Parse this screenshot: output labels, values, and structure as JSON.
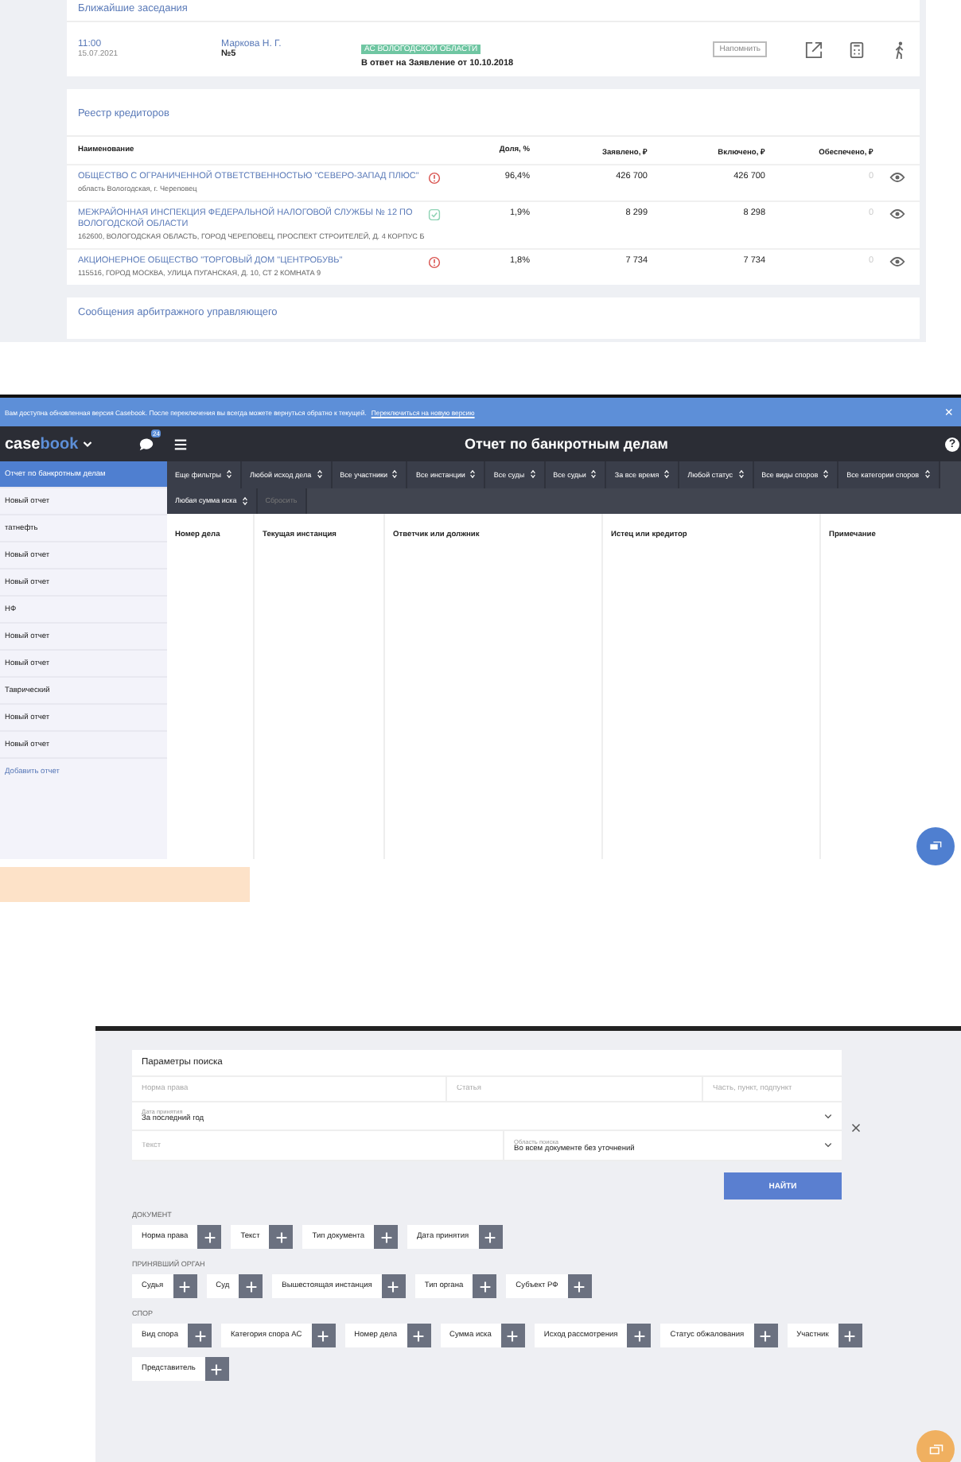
{
  "hearings": {
    "title": "Ближайшие заседания",
    "rows": [
      {
        "time": "11:00",
        "date": "15.07.2021",
        "judge": "Маркова Н. Г.",
        "room": "№5",
        "court_tag": "АС ВОЛОГОДСКОЙ ОБЛАСТИ",
        "description": "В ответ на Заявление от 10.10.2018",
        "remind_button": "Напомнить"
      }
    ]
  },
  "creditors": {
    "title": "Реестр кредиторов",
    "columns": [
      "Наименование",
      "Доля, %",
      "Заявлено, ₽",
      "Включено, ₽",
      "Обеспечено, ₽"
    ],
    "rows": [
      {
        "name": "ОБЩЕСТВО С ОГРАНИЧЕННОЙ ОТВЕТСТВЕННОСТЬЮ \"СЕВЕРО-ЗАПАД ПЛЮС\"",
        "address": "область Вологодская, г. Череповец",
        "kind": "alert",
        "share": "96,4%",
        "claimed": "426 700",
        "included": "426 700",
        "secured": "0"
      },
      {
        "name": "МЕЖРАЙОННАЯ ИНСПЕКЦИЯ ФЕДЕРАЛЬНОЙ НАЛОГОВОЙ СЛУЖБЫ № 12 ПО ВОЛОГОДСКОЙ ОБЛАСТИ",
        "address": "162600, ВОЛОГОДСКАЯ ОБЛАСТЬ, ГОРОД ЧЕРЕПОВЕЦ, ПРОСПЕКТ СТРОИТЕЛЕЙ, Д. 4 КОРПУС Б",
        "kind": "check",
        "share": "1,9%",
        "claimed": "8 299",
        "included": "8 298",
        "secured": "0"
      },
      {
        "name": "АКЦИОНЕРНОЕ ОБЩЕСТВО \"ТОРГОВЫЙ ДОМ \"ЦЕНТРОБУВЬ\"",
        "address": "115516, ГОРОД МОСКВА, УЛИЦА ПУГАНСКАЯ, Д. 10, СТ 2 КОМНАТА 9",
        "kind": "alert",
        "share": "1,8%",
        "claimed": "7 734",
        "included": "7 734",
        "secured": "0"
      }
    ]
  },
  "messages": {
    "title": "Сообщения арбитражного управляющего"
  },
  "banner": {
    "text": "Вам доступна обновленная версия Casebook. После переключения вы всегда можете вернуться обратно к текущей.",
    "link": "Переключиться на новую версию",
    "close": "×"
  },
  "app": {
    "logo_a": "case",
    "logo_b": "book",
    "chat_badge": "24",
    "title": "Отчет по банкротным делам",
    "help": "?"
  },
  "filters": [
    {
      "label": "Еще фильтры",
      "disabled": false
    },
    {
      "label": "Любой исход дела",
      "disabled": false
    },
    {
      "label": "Все участники",
      "disabled": false
    },
    {
      "label": "Все инстанции",
      "disabled": false
    },
    {
      "label": "Все суды",
      "disabled": false
    },
    {
      "label": "Все судьи",
      "disabled": false
    },
    {
      "label": "За все время",
      "disabled": false
    },
    {
      "label": "Любой статус",
      "disabled": false
    },
    {
      "label": "Все виды споров",
      "disabled": false
    },
    {
      "label": "Все категории споров",
      "disabled": false
    },
    {
      "label": "Любая сумма иска",
      "disabled": false
    },
    {
      "label": "Сбросить",
      "disabled": true
    }
  ],
  "report_columns": [
    "Номер дела",
    "Текущая инстанция",
    "Ответчик или должник",
    "Истец или кредитор",
    "Примечание"
  ],
  "sidebar": {
    "items": [
      {
        "label": "Отчет по банкротным делам",
        "selected": true
      },
      {
        "label": "Новый отчет",
        "selected": false
      },
      {
        "label": "татнефть",
        "selected": false
      },
      {
        "label": "Новый отчет",
        "selected": false
      },
      {
        "label": "Новый отчет",
        "selected": false
      },
      {
        "label": "НФ",
        "selected": false
      },
      {
        "label": "Новый отчет",
        "selected": false
      },
      {
        "label": "Новый отчет",
        "selected": false
      },
      {
        "label": "Таврический",
        "selected": false
      },
      {
        "label": "Новый отчет",
        "selected": false
      },
      {
        "label": "Новый отчет",
        "selected": false
      }
    ],
    "add_link": "Добавить отчет"
  },
  "search": {
    "title": "Параметры поиска",
    "fields": [
      {
        "placeholder": "Норма права"
      },
      {
        "placeholder": "Статья"
      },
      {
        "placeholder": "Часть, пункт, подпункт"
      }
    ],
    "date_select": {
      "label": "Дата принятия",
      "value": "За последний год"
    },
    "text_field": {
      "placeholder": "Текст"
    },
    "area_select": {
      "label": "Область поиска",
      "value": "Во всем документе без уточнений"
    },
    "button": "НАЙТИ"
  },
  "groups": [
    {
      "title": "ДОКУМЕНТ",
      "chips": [
        "Норма права",
        "Текст",
        "Тип документа",
        "Дата принятия"
      ]
    },
    {
      "title": "ПРИНЯВШИЙ ОРГАН",
      "chips": [
        "Судья",
        "Суд",
        "Вышестоящая инстанция",
        "Тип органа",
        "Субъект РФ"
      ]
    },
    {
      "title": "СПОР",
      "chips": [
        "Вид спора",
        "Категория спора АС",
        "Номер дела",
        "Сумма иска",
        "Исход рассмотрения",
        "Статус обжалования",
        "Участник",
        "Представитель"
      ]
    }
  ]
}
